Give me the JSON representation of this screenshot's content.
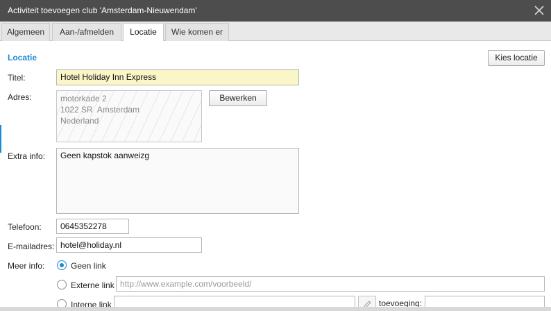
{
  "window": {
    "title": "Activiteit toevoegen club 'Amsterdam-Nieuwendam'",
    "close_icon": "close-icon"
  },
  "tabs": [
    {
      "label": "Algemeen",
      "active": false
    },
    {
      "label": "Aan-/afmelden",
      "active": false
    },
    {
      "label": "Locatie",
      "active": true
    },
    {
      "label": "Wie komen er",
      "active": false
    }
  ],
  "section": {
    "title": "Locatie",
    "choose_location_button": "Kies locatie"
  },
  "form": {
    "title_label": "Titel:",
    "title_value": "Hotel Holiday Inn Express",
    "address_label": "Adres:",
    "address_lines": [
      "motorkade 2",
      "1022 SR  Amsterdam",
      "Nederland"
    ],
    "edit_button": "Bewerken",
    "extra_info_label": "Extra info:",
    "extra_info_value": "Geen kapstok aanweizg",
    "phone_label": "Telefoon:",
    "phone_value": "0645352278",
    "email_label": "E-mailadres:",
    "email_value": "hotel@holiday.nl",
    "more_info_label": "Meer info:",
    "more_info_options": [
      {
        "label": "Geen link",
        "checked": true
      },
      {
        "label": "Externe link",
        "checked": false
      },
      {
        "label": "Interne link",
        "checked": false
      }
    ],
    "external_link_placeholder": "http://www.example.com/voorbeeld/",
    "internal_link_value": "",
    "suffix_label": "toevoeging:",
    "suffix_value": ""
  },
  "colors": {
    "accent": "#1b8bd1",
    "titlebar": "#4d4d4d",
    "highlight_input": "#fbf6c8"
  }
}
